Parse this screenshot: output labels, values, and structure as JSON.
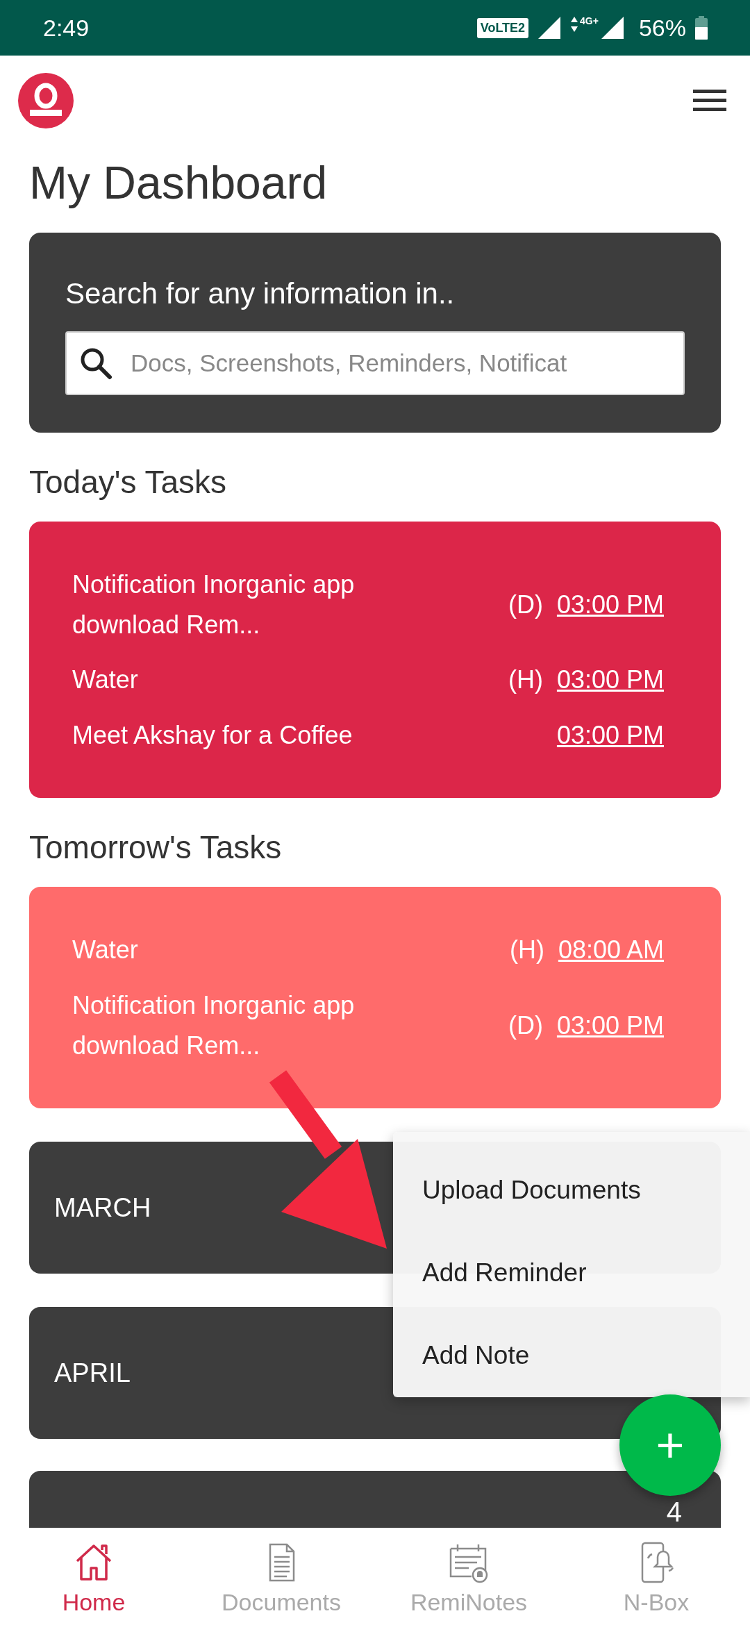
{
  "status_bar": {
    "time": "2:49",
    "volte": "VoLTE2",
    "network": "4G+",
    "battery": "56%"
  },
  "title": "My Dashboard",
  "search": {
    "heading": "Search for any information in..",
    "placeholder": "Docs, Screenshots, Reminders, Notificat"
  },
  "sections": [
    {
      "heading": "Today's Tasks",
      "kind": "today",
      "tasks": [
        {
          "title": "Notification Inorganic app download Rem...",
          "tag": "(D)",
          "time": "03:00 PM"
        },
        {
          "title": "Water",
          "tag": "(H)",
          "time": "03:00 PM"
        },
        {
          "title": "Meet Akshay for a Coffee",
          "time": "03:00 PM"
        }
      ]
    },
    {
      "heading": "Tomorrow's Tasks",
      "kind": "tomorrow",
      "tasks": [
        {
          "title": "Water",
          "tag": "(H)",
          "time": "08:00 AM"
        },
        {
          "title": "Notification Inorganic app download Rem...",
          "tag": "(D)",
          "time": "03:00 PM"
        }
      ]
    }
  ],
  "months": [
    {
      "name": "MARCH"
    },
    {
      "name": "APRIL"
    },
    {
      "count": "4"
    }
  ],
  "menu": [
    "Upload Documents",
    "Add Reminder",
    "Add Note"
  ],
  "fab": "+",
  "nav": [
    {
      "label": "Home",
      "selected": true
    },
    {
      "label": "Documents",
      "selected": false
    },
    {
      "label": "RemiNotes",
      "selected": false
    },
    {
      "label": "N-Box",
      "selected": false
    }
  ]
}
